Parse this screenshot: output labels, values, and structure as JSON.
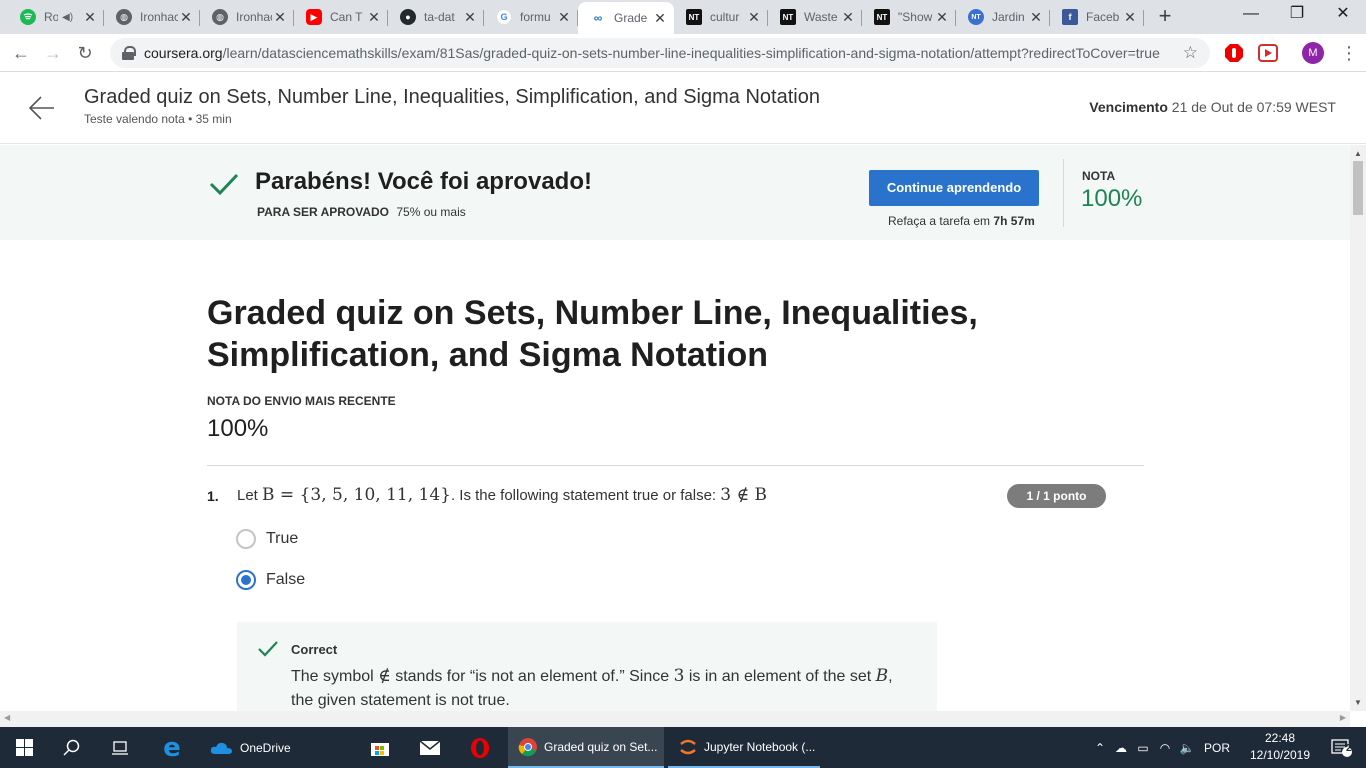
{
  "browser": {
    "tabs": [
      {
        "title": "Ro",
        "favicon": "spotify-icon",
        "color": "#1db954",
        "audio": true
      },
      {
        "title": "Ironhack",
        "favicon": "globe-icon",
        "color": "#5f6368"
      },
      {
        "title": "Ironhack",
        "favicon": "globe-icon",
        "color": "#5f6368"
      },
      {
        "title": "Can T",
        "favicon": "youtube-icon",
        "color": "#ff0000"
      },
      {
        "title": "ta-dat",
        "favicon": "github-icon",
        "color": "#24292e"
      },
      {
        "title": "formu",
        "favicon": "google-icon",
        "color": "#4285f4"
      },
      {
        "title": "Grade",
        "favicon": "coursera-icon",
        "color": "#2a73cc",
        "active": true
      },
      {
        "title": "cultur",
        "favicon": "nt-icon",
        "color": "#111111"
      },
      {
        "title": "Waste",
        "favicon": "nt-icon",
        "color": "#111111"
      },
      {
        "title": "\"Show",
        "favicon": "nt-icon",
        "color": "#111111"
      },
      {
        "title": "Jardin",
        "favicon": "nt-circle-icon",
        "color": "#3b6fd1"
      },
      {
        "title": "Faceb",
        "favicon": "facebook-icon",
        "color": "#3b5998"
      }
    ],
    "url_host": "coursera.org",
    "url_path": "/learn/datasciencemathskills/exam/81Sas/graded-quiz-on-sets-number-line-inequalities-simplification-and-sigma-notation/attempt?redirectToCover=true",
    "profile_initial": "M"
  },
  "header": {
    "title": "Graded quiz on Sets, Number Line, Inequalities, Simplification, and Sigma Notation",
    "subtitle": "Teste valendo nota • 35 min",
    "due_label": "Vencimento",
    "due_value": "21 de Out de 07:59 WEST"
  },
  "banner": {
    "title": "Parabéns! Você foi aprovado!",
    "pass_label": "PARA SER APROVADO",
    "pass_value": "75% ou mais",
    "continue_label": "Continue aprendendo",
    "retake_prefix": "Refaça a tarefa em",
    "retake_time": "7h 57m",
    "grade_label": "NOTA",
    "grade_value": "100%"
  },
  "quiz": {
    "title": "Graded quiz on Sets, Number Line, Inequalities, Simplification, and Sigma Notation",
    "recent_label": "NOTA DO ENVIO MAIS RECENTE",
    "recent_value": "100%",
    "question": {
      "number": "1.",
      "text_prefix": "Let",
      "math_set": "B = {3, 5, 10, 11, 14}",
      "text_middle": ". Is the following statement true or false:",
      "math_statement": "3 ∉ B",
      "points": "1 / 1 ponto",
      "options": [
        {
          "label": "True",
          "selected": false
        },
        {
          "label": "False",
          "selected": true
        }
      ],
      "feedback": {
        "title": "Correct",
        "text_1": "The symbol",
        "symbol": "∉",
        "text_2": "stands for “is not an element of.” Since",
        "math_3": "3",
        "text_3": "is in an element of the set",
        "math_B": "B",
        "text_4": ", the given statement is not true."
      }
    }
  },
  "taskbar": {
    "apps": [
      {
        "label": "OneDrive"
      },
      {
        "label": "Graded quiz on Set..."
      },
      {
        "label": "Jupyter Notebook (..."
      }
    ],
    "language": "POR",
    "time": "22:48",
    "date": "12/10/2019",
    "notifications": "2"
  },
  "colors": {
    "accent": "#2a73cc",
    "success": "#1f8354",
    "banner_bg": "#f3f8f6",
    "taskbar_bg": "#1e2a37"
  }
}
